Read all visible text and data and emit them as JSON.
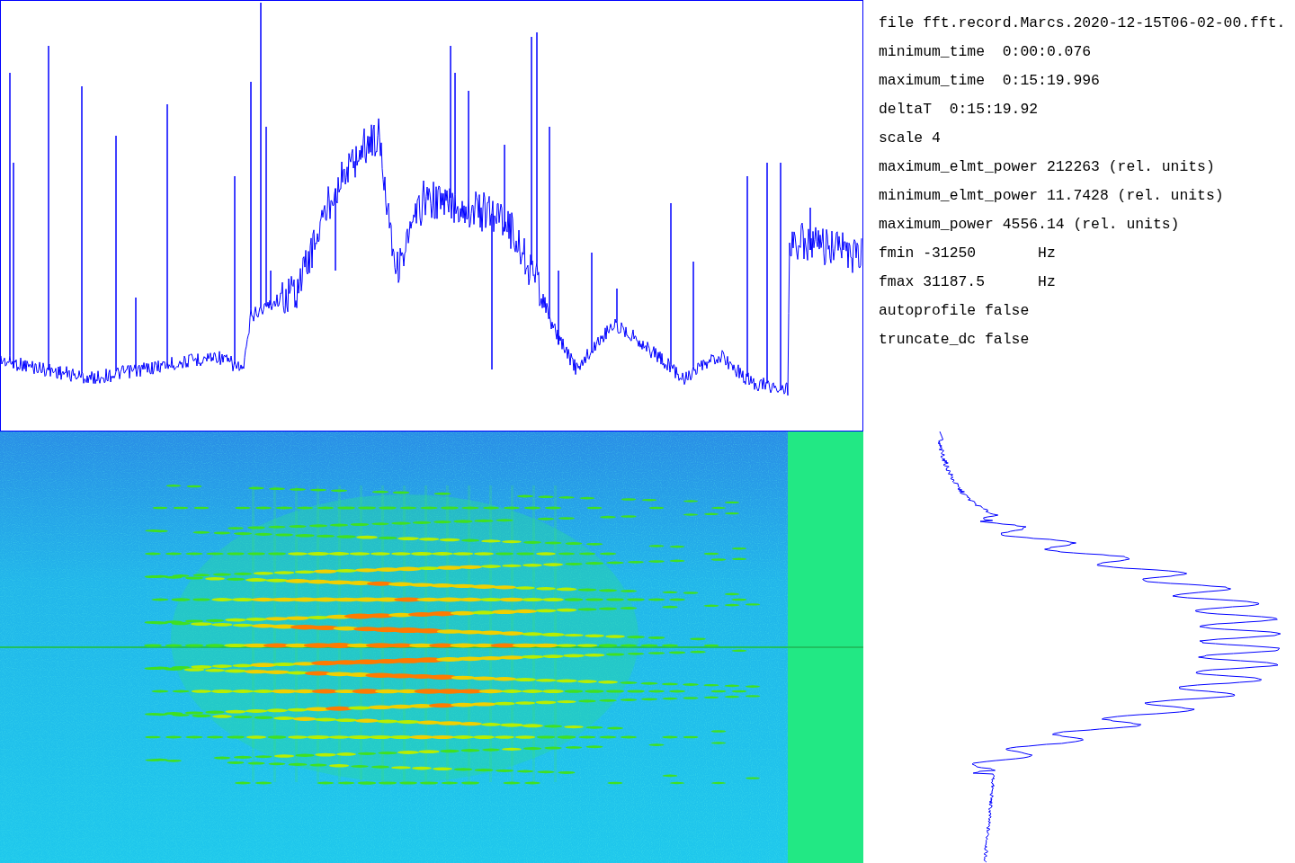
{
  "panels": [
    {
      "kind": "power-trace"
    },
    {
      "kind": "spectrogram"
    },
    {
      "kind": "frequency-profile"
    }
  ],
  "info_lines": [
    {
      "text": "file fft.record.Marcs.2020-12-15T06-02-00.fft."
    },
    {
      "text": "minimum_time  0:00:0.076"
    },
    {
      "text": "maximum_time  0:15:19.996"
    },
    {
      "text": "deltaT  0:15:19.92"
    },
    {
      "text": "scale 4"
    },
    {
      "text": "maximum_elmt_power 212263 (rel. units)"
    },
    {
      "text": "minimum_elmt_power 11.7428 (rel. units)"
    },
    {
      "text": "maximum_power 4556.14 (rel. units)"
    },
    {
      "text": "fmin -31250       Hz"
    },
    {
      "text": "fmax 31187.5      Hz"
    },
    {
      "text": "autoprofile false"
    },
    {
      "text": "truncate_dc false"
    }
  ]
}
